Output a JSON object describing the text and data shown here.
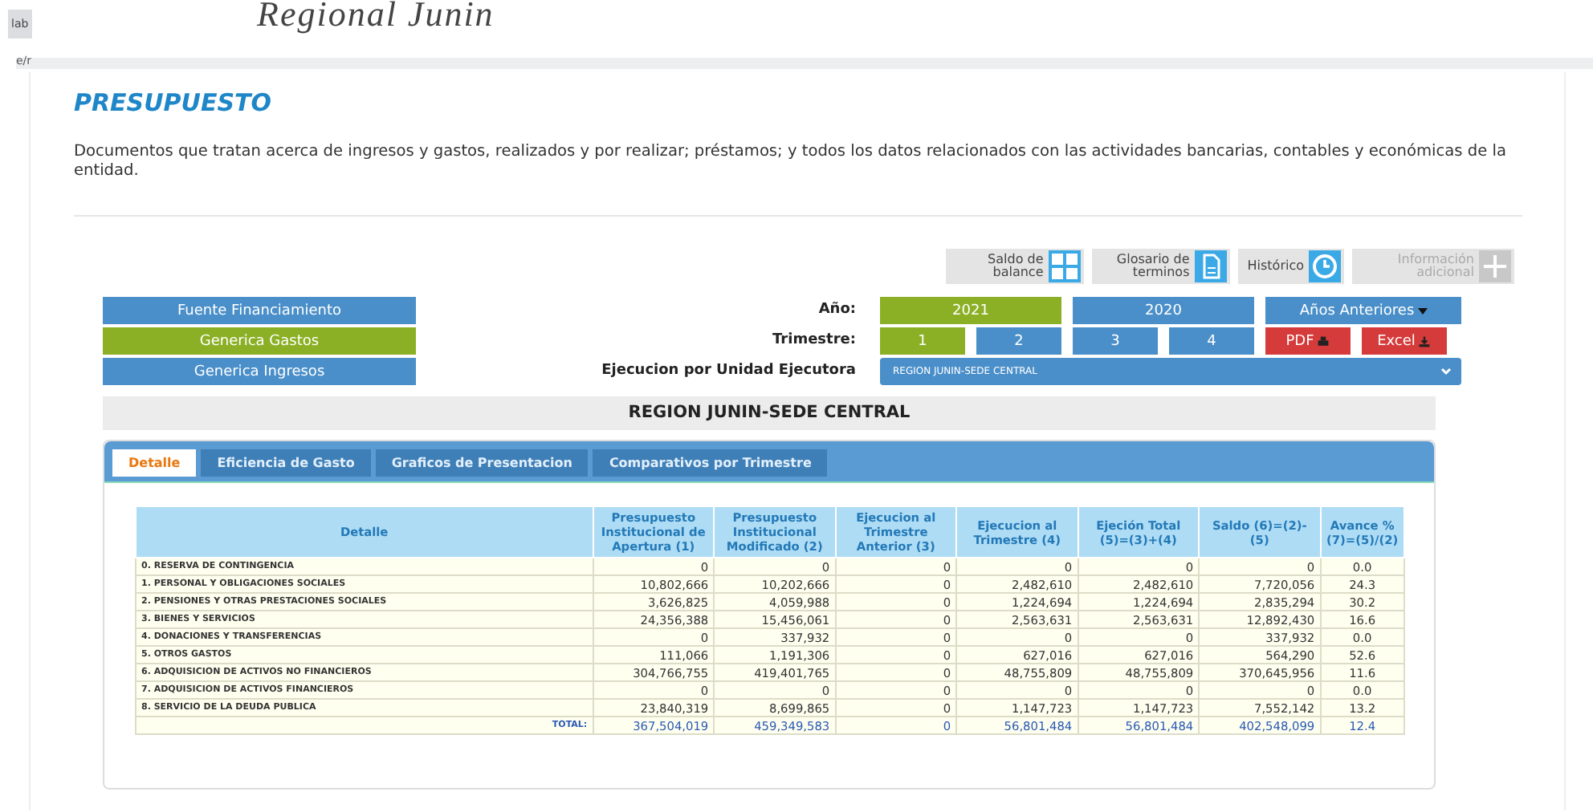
{
  "browser": {
    "tab_label": "lab",
    "header_title": "Regional Junin",
    "address": "e/r"
  },
  "page": {
    "title": "PRESUPUESTO",
    "description": "Documentos que tratan acerca de ingresos y gastos, realizados y por realizar; préstamos; y todos los datos relacionados con las actividades bancarias, contables y económicas de la entidad."
  },
  "tools": [
    {
      "label": "Saldo de balance",
      "kind": "calculator",
      "disabled": false
    },
    {
      "label": "Glosario de terminos",
      "kind": "document",
      "disabled": false
    },
    {
      "label": "Histórico",
      "kind": "clock",
      "disabled": false
    },
    {
      "label": "Información adicional",
      "kind": "plus",
      "disabled": true
    }
  ],
  "categories": [
    {
      "label": "Fuente Financiamiento",
      "selected": false
    },
    {
      "label": "Generica Gastos",
      "selected": true
    },
    {
      "label": "Generica Ingresos",
      "selected": false
    }
  ],
  "filters": {
    "year_label": "Año:",
    "years": [
      {
        "label": "2021",
        "selected": true
      },
      {
        "label": "2020",
        "selected": false
      }
    ],
    "previous_years": "Años Anteriores",
    "quarter_label": "Trimestre:",
    "quarters": [
      {
        "label": "1",
        "selected": true
      },
      {
        "label": "2",
        "selected": false
      },
      {
        "label": "3",
        "selected": false
      },
      {
        "label": "4",
        "selected": false
      }
    ],
    "exports": [
      {
        "label": "PDF",
        "kind": "print"
      },
      {
        "label": "Excel",
        "kind": "download"
      }
    ],
    "unit_label": "Ejecucion por Unidad Ejecutora",
    "unit_value": "REGION JUNIN-SEDE CENTRAL"
  },
  "section_title": "REGION JUNIN-SEDE CENTRAL",
  "tabs": [
    {
      "label": "Detalle",
      "selected": true
    },
    {
      "label": "Eficiencia de Gasto",
      "selected": false
    },
    {
      "label": "Graficos de Presentacion",
      "selected": false
    },
    {
      "label": "Comparativos por Trimestre",
      "selected": false
    }
  ],
  "table": {
    "columns": [
      "Detalle",
      "Presupuesto Institucional de Apertura (1)",
      "Presupuesto Institucional Modificado (2)",
      "Ejecucion al Trimestre Anterior (3)",
      "Ejecucion al Trimestre (4)",
      "Ejeción Total (5)=(3)+(4)",
      "Saldo (6)=(2)-(5)",
      "Avance % (7)=(5)/(2)"
    ],
    "rows": [
      [
        "0. RESERVA DE CONTINGENCIA",
        "0",
        "0",
        "0",
        "0",
        "0",
        "0",
        "0.0"
      ],
      [
        "1. PERSONAL Y OBLIGACIONES SOCIALES",
        "10,802,666",
        "10,202,666",
        "0",
        "2,482,610",
        "2,482,610",
        "7,720,056",
        "24.3"
      ],
      [
        "2. PENSIONES Y OTRAS PRESTACIONES SOCIALES",
        "3,626,825",
        "4,059,988",
        "0",
        "1,224,694",
        "1,224,694",
        "2,835,294",
        "30.2"
      ],
      [
        "3. BIENES Y SERVICIOS",
        "24,356,388",
        "15,456,061",
        "0",
        "2,563,631",
        "2,563,631",
        "12,892,430",
        "16.6"
      ],
      [
        "4. DONACIONES Y TRANSFERENCIAS",
        "0",
        "337,932",
        "0",
        "0",
        "0",
        "337,932",
        "0.0"
      ],
      [
        "5. OTROS GASTOS",
        "111,066",
        "1,191,306",
        "0",
        "627,016",
        "627,016",
        "564,290",
        "52.6"
      ],
      [
        "6. ADQUISICION DE ACTIVOS NO FINANCIEROS",
        "304,766,755",
        "419,401,765",
        "0",
        "48,755,809",
        "48,755,809",
        "370,645,956",
        "11.6"
      ],
      [
        "7. ADQUISICION DE ACTIVOS FINANCIEROS",
        "0",
        "0",
        "0",
        "0",
        "0",
        "0",
        "0.0"
      ],
      [
        "8. SERVICIO DE LA DEUDA PUBLICA",
        "23,840,319",
        "8,699,865",
        "0",
        "1,147,723",
        "1,147,723",
        "7,552,142",
        "13.2"
      ]
    ],
    "total": [
      "TOTAL:",
      "367,504,019",
      "459,349,583",
      "0",
      "56,801,484",
      "56,801,484",
      "402,548,099",
      "12.4"
    ]
  }
}
